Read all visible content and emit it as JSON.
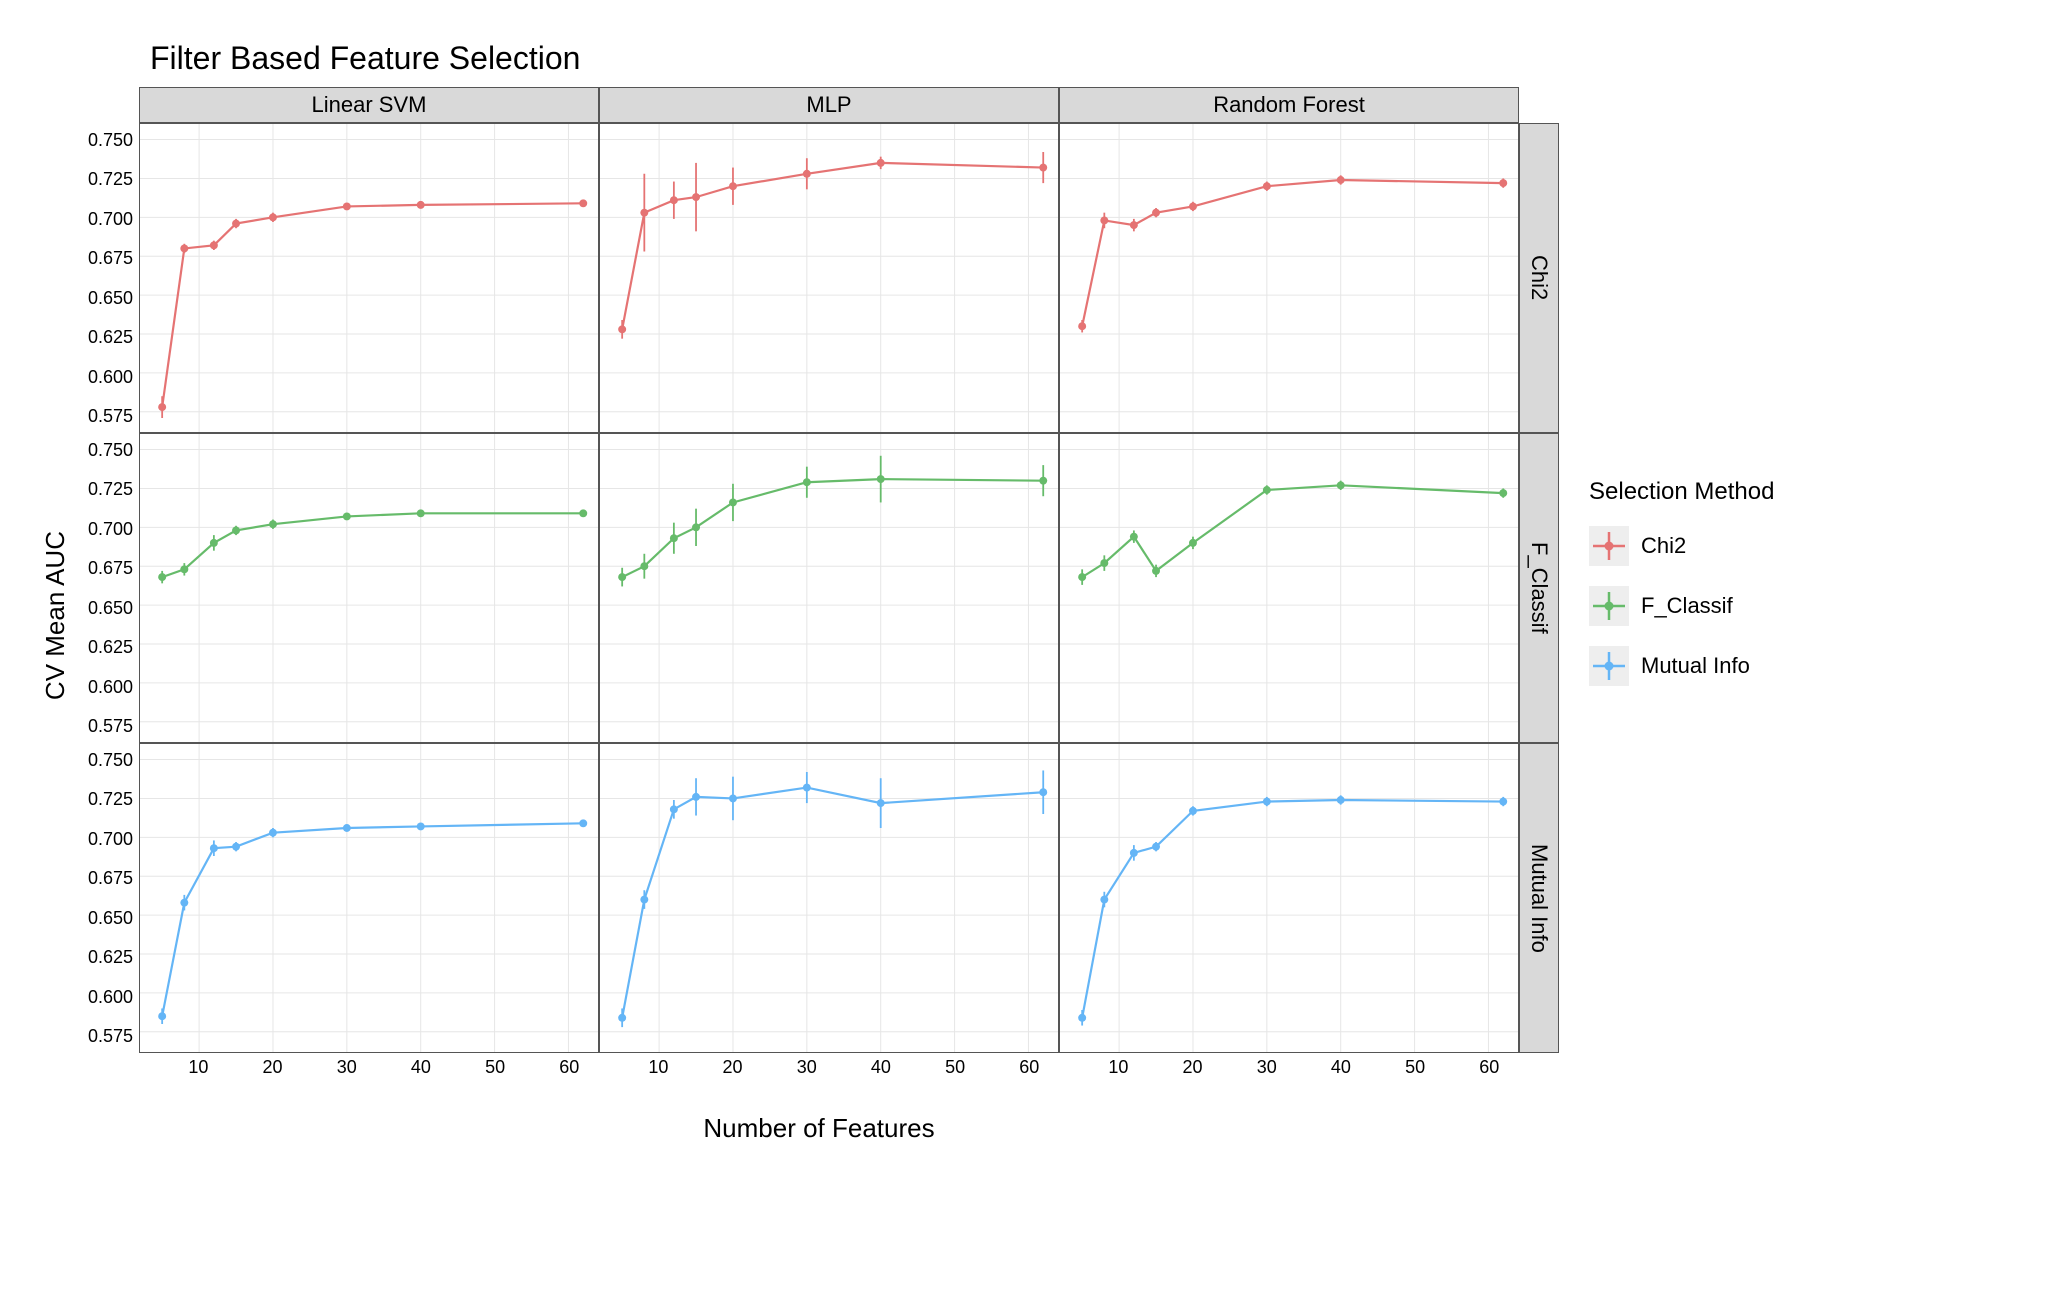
{
  "title": "Filter Based Feature Selection",
  "xlabel": "Number of Features",
  "ylabel": "CV Mean AUC",
  "legend_title": "Selection Method",
  "columns": [
    "Linear SVM",
    "MLP",
    "Random Forest"
  ],
  "rows": [
    "Chi2",
    "F_Classif",
    "Mutual Info"
  ],
  "colors": {
    "Chi2": "#e57373",
    "F_Classif": "#66bb6a",
    "Mutual Info": "#64b5f6"
  },
  "legend_items": [
    "Chi2",
    "F_Classif",
    "Mutual Info"
  ],
  "x_ticks": [
    10,
    20,
    30,
    40,
    50,
    60
  ],
  "y_ticks": [
    0.575,
    0.6,
    0.625,
    0.65,
    0.675,
    0.7,
    0.725,
    0.75
  ],
  "y_tick_labels": [
    "0.575",
    "0.600",
    "0.625",
    "0.650",
    "0.675",
    "0.700",
    "0.725",
    "0.750"
  ],
  "xlim": [
    2,
    64
  ],
  "ylim": [
    0.562,
    0.76
  ],
  "chart_data": {
    "type": "line",
    "facets": {
      "columns": [
        "Linear SVM",
        "MLP",
        "Random Forest"
      ],
      "rows": [
        "Chi2",
        "F_Classif",
        "Mutual Info"
      ]
    },
    "x": [
      5,
      8,
      12,
      15,
      20,
      30,
      40,
      62
    ],
    "panels": {
      "Chi2|Linear SVM": {
        "y": [
          0.578,
          0.68,
          0.682,
          0.696,
          0.7,
          0.707,
          0.708,
          0.709
        ],
        "err": [
          0.007,
          0.003,
          0.003,
          0.003,
          0.003,
          0.002,
          0.002,
          0.002
        ]
      },
      "Chi2|MLP": {
        "y": [
          0.628,
          0.703,
          0.711,
          0.713,
          0.72,
          0.728,
          0.735,
          0.732
        ],
        "err": [
          0.006,
          0.025,
          0.012,
          0.022,
          0.012,
          0.01,
          0.004,
          0.01
        ]
      },
      "Chi2|Random Forest": {
        "y": [
          0.63,
          0.698,
          0.695,
          0.703,
          0.707,
          0.72,
          0.724,
          0.722
        ],
        "err": [
          0.004,
          0.005,
          0.004,
          0.003,
          0.003,
          0.003,
          0.003,
          0.003
        ]
      },
      "F_Classif|Linear SVM": {
        "y": [
          0.668,
          0.673,
          0.69,
          0.698,
          0.702,
          0.707,
          0.709,
          0.709
        ],
        "err": [
          0.004,
          0.004,
          0.005,
          0.003,
          0.003,
          0.002,
          0.002,
          0.002
        ]
      },
      "F_Classif|MLP": {
        "y": [
          0.668,
          0.675,
          0.693,
          0.7,
          0.716,
          0.729,
          0.731,
          0.73
        ],
        "err": [
          0.006,
          0.008,
          0.01,
          0.012,
          0.012,
          0.01,
          0.015,
          0.01
        ]
      },
      "F_Classif|Random Forest": {
        "y": [
          0.668,
          0.677,
          0.694,
          0.672,
          0.69,
          0.724,
          0.727,
          0.722
        ],
        "err": [
          0.005,
          0.005,
          0.004,
          0.004,
          0.004,
          0.003,
          0.003,
          0.003
        ]
      },
      "Mutual Info|Linear SVM": {
        "y": [
          0.585,
          0.658,
          0.693,
          0.694,
          0.703,
          0.706,
          0.707,
          0.709
        ],
        "err": [
          0.005,
          0.005,
          0.005,
          0.003,
          0.003,
          0.002,
          0.002,
          0.002
        ]
      },
      "Mutual Info|MLP": {
        "y": [
          0.584,
          0.66,
          0.718,
          0.726,
          0.725,
          0.732,
          0.722,
          0.729
        ],
        "err": [
          0.006,
          0.006,
          0.006,
          0.012,
          0.014,
          0.01,
          0.016,
          0.014
        ]
      },
      "Mutual Info|Random Forest": {
        "y": [
          0.584,
          0.66,
          0.69,
          0.694,
          0.717,
          0.723,
          0.724,
          0.723
        ],
        "err": [
          0.005,
          0.005,
          0.005,
          0.003,
          0.003,
          0.003,
          0.003,
          0.003
        ]
      }
    }
  }
}
